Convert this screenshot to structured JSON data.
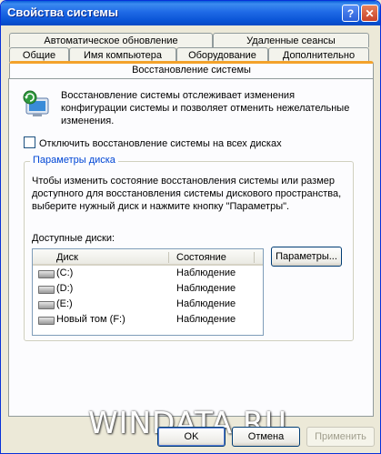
{
  "window": {
    "title": "Свойства системы",
    "help_glyph": "?",
    "close_glyph": "✕"
  },
  "tabs": {
    "row1": [
      "Автоматическое обновление",
      "Удаленные сеансы"
    ],
    "row2": [
      "Общие",
      "Имя компьютера",
      "Оборудование",
      "Дополнительно"
    ],
    "active": "Восстановление системы"
  },
  "intro": {
    "icon": "system-restore-icon",
    "text": "Восстановление системы отслеживает изменения конфигурации системы и позволяет отменить нежелательные изменения."
  },
  "disable_checkbox": {
    "label": "Отключить восстановление системы на всех дисках",
    "checked": false
  },
  "disk_settings": {
    "title": "Параметры диска",
    "description": "Чтобы изменить состояние восстановления системы или размер доступного для восстановления системы дискового пространства, выберите нужный диск и нажмите кнопку \"Параметры\".",
    "available_label": "Доступные диски:",
    "columns": [
      "Диск",
      "Состояние"
    ],
    "drives": [
      {
        "name": "(C:)",
        "state": "Наблюдение"
      },
      {
        "name": "(D:)",
        "state": "Наблюдение"
      },
      {
        "name": "(E:)",
        "state": "Наблюдение"
      },
      {
        "name": "Новый том (F:)",
        "state": "Наблюдение"
      }
    ],
    "settings_button": "Параметры..."
  },
  "footer": {
    "ok": "OK",
    "cancel": "Отмена",
    "apply": "Применить"
  },
  "watermark": "WINDATA.RU"
}
